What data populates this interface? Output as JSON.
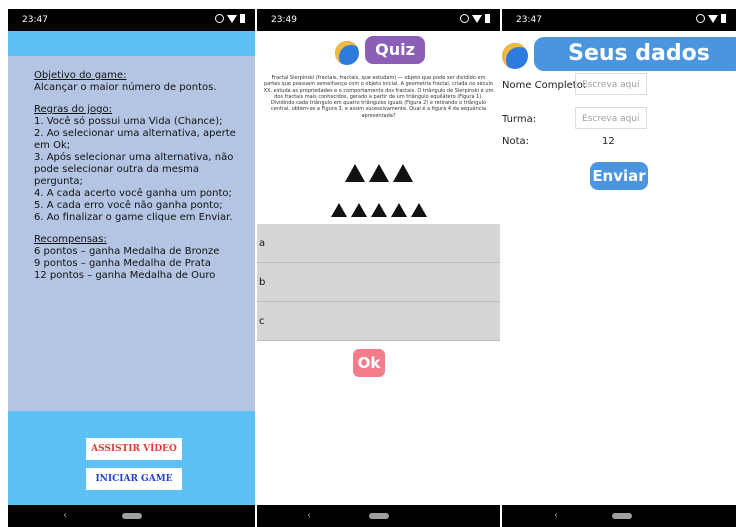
{
  "screens": [
    {
      "time": "23:47"
    },
    {
      "time": "23:49"
    },
    {
      "time": "23:47"
    }
  ],
  "navbar": {
    "back_glyph": "‹"
  },
  "rules": {
    "objective_title": "Objetivo do game:",
    "objective_text": "Alcançar o maior número de pontos.",
    "rules_title": "Regras do jogo:",
    "rules_items": [
      "1. Você só possui uma Vida (Chance);",
      "2. Ao selecionar uma alternativa, aperte em Ok;",
      "3. Após selecionar uma alternativa, não pode selecionar outra da mesma pergunta;",
      "4. A cada acerto você ganha um ponto;",
      "5. A cada erro você não ganha ponto;",
      "6. Ao finalizar o game clique em Enviar."
    ],
    "rewards_title": "Recompensas:",
    "rewards": [
      "6 pontos – ganha Medalha de Bronze",
      "9 pontos – ganha Medalha de Prata",
      "12 pontos – ganha Medalha de Ouro"
    ],
    "watch_video_button": "ASSISTIR VÍDEO",
    "start_game_button": "INICIAR GAME"
  },
  "quiz": {
    "title": "Quiz",
    "question_text": "Fractal Sierpinski (fractais, fractais, que estudam) — objeto que pode ser dividido em partes que possuem semelhança com o objeto inicial. A geometria fractal, criada no século XX, estuda as propriedades e o comportamento dos fractais. O triângulo de Sierpinski é um dos fractais mais conhecidos, gerado a partir de um triângulo equilátero (Figura 1). Dividindo cada triângulo em quatro triângulos iguais (Figura 2) e retirando o triângulo central, obtém-se a Figura 3, e assim sucessivamente. Qual é a figura 4 da sequência apresentada?",
    "options": [
      "a",
      "b",
      "c"
    ],
    "ok_button": "Ok"
  },
  "form": {
    "title": "Seus dados",
    "name_label": "Nome Completo:",
    "name_placeholder": "Escreva aqui",
    "class_label": "Turma:",
    "class_placeholder": "Escreva aqui",
    "grade_label": "Nota:",
    "grade_value": "12",
    "submit_button": "Enviar"
  },
  "colors": {
    "sky": "#5ec1f5",
    "rules_panel": "#b4c5e4",
    "quiz_purple": "#8b5fb8",
    "ok_pink": "#f47d8b",
    "brand_blue": "#4b95de"
  }
}
